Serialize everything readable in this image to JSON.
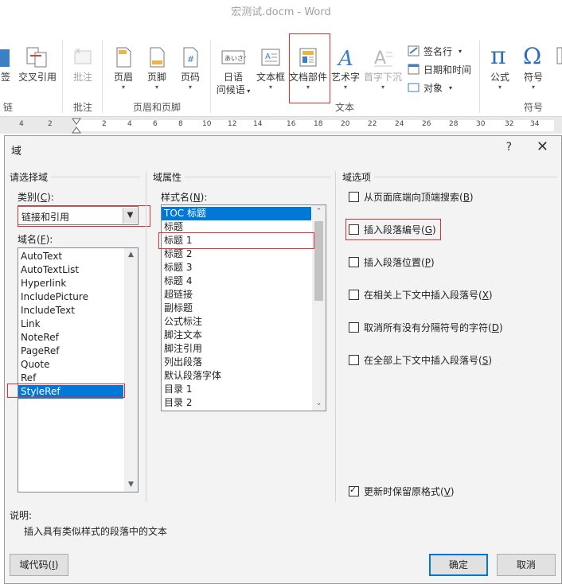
{
  "window": {
    "title": "宏测试.docm - Word"
  },
  "ribbon": {
    "partial_left_1": "签",
    "partial_left_2": "链接",
    "cross_ref": "交叉引用",
    "comment": "批注",
    "header": "页眉",
    "footer": "页脚",
    "page_number": "页码",
    "greeting_line1": "日语",
    "greeting_line2": "问候语",
    "text_box": "文本框",
    "quick_parts": "文档部件",
    "wordart": "艺术字",
    "drop_cap": "首字下沉",
    "signature_line": "签名行",
    "date_time": "日期和时间",
    "object": "对象",
    "equation": "公式",
    "symbol": "符号",
    "groups": {
      "comments": "批注",
      "header_footer": "页眉和页脚",
      "text": "文本",
      "symbols": "符号"
    }
  },
  "ruler": {
    "ticks": [
      "4",
      "2",
      "2",
      "4",
      "6",
      "8",
      "10",
      "12",
      "14",
      "16",
      "18",
      "20",
      "22",
      "24",
      "26",
      "28",
      "30",
      "32",
      "34"
    ]
  },
  "dialog": {
    "title": "域",
    "help": "?",
    "close": "✕",
    "choose_field": {
      "heading": "请选择域",
      "category_label": "类别(",
      "category_key": "C",
      "category_label_end": "):",
      "category_value": "链接和引用",
      "field_names_label": "域名(",
      "field_names_key": "F",
      "field_names_label_end": "):",
      "field_names": [
        "AutoText",
        "AutoTextList",
        "Hyperlink",
        "IncludePicture",
        "IncludeText",
        "Link",
        "NoteRef",
        "PageRef",
        "Quote",
        "Ref",
        "StyleRef"
      ],
      "selected_field": "StyleRef"
    },
    "field_properties": {
      "heading": "域属性",
      "style_name_label": "样式名(",
      "style_name_key": "N",
      "style_name_label_end": "):",
      "styles": [
        "TOC 标题",
        "标题",
        "标题 1",
        "标题 2",
        "标题 3",
        "标题 4",
        "超链接",
        "副标题",
        "公式标注",
        "脚注文本",
        "脚注引用",
        "列出段落",
        "默认段落字体",
        "目录 1",
        "目录 2"
      ],
      "selected_style": "TOC 标题"
    },
    "field_options": {
      "heading": "域选项",
      "options": [
        {
          "label": "从页面底端向顶端搜索(",
          "key": "B",
          "end": ")",
          "checked": false
        },
        {
          "label": "插入段落编号(",
          "key": "G",
          "end": ")",
          "checked": false
        },
        {
          "label": "插入段落位置(",
          "key": "P",
          "end": ")",
          "checked": false
        },
        {
          "label": "在相关上下文中插入段落号(",
          "key": "X",
          "end": ")",
          "checked": false
        },
        {
          "label": "取消所有没有分隔符号的字符(",
          "key": "D",
          "end": ")",
          "checked": false
        },
        {
          "label": "在全部上下文中插入段落号(",
          "key": "S",
          "end": ")",
          "checked": false
        }
      ],
      "preserve": {
        "label": "更新时保留原格式(",
        "key": "V",
        "end": ")",
        "checked": true
      }
    },
    "description": {
      "label": "说明:",
      "text": "插入具有类似样式的段落中的文本"
    },
    "buttons": {
      "field_codes": "域代码(",
      "field_codes_key": "I",
      "field_codes_end": ")",
      "ok": "确定",
      "cancel": "取消"
    }
  },
  "colors": {
    "selection": "#0078d7",
    "highlight_box": "#e03030",
    "dialog_bg": "#f3f3f3"
  }
}
